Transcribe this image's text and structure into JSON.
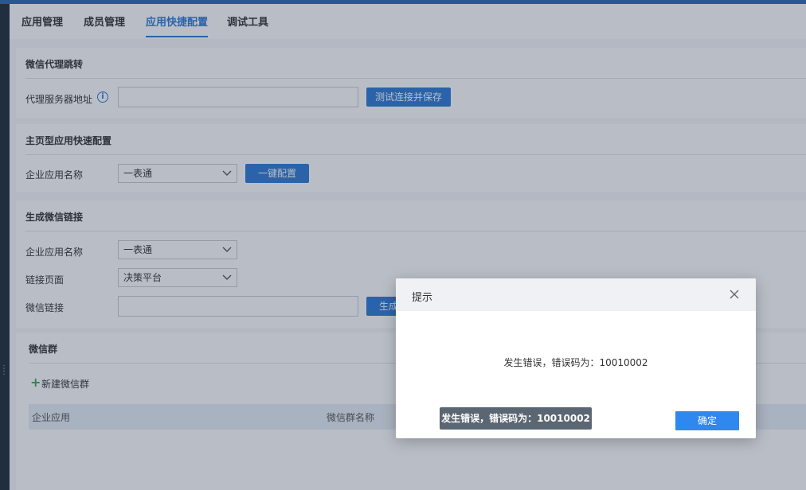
{
  "tabs": [
    {
      "label": "应用管理"
    },
    {
      "label": "成员管理"
    },
    {
      "label": "应用快捷配置"
    },
    {
      "label": "调试工具"
    }
  ],
  "proxy": {
    "title": "微信代理跳转",
    "address_label": "代理服务器地址",
    "address_value": "",
    "test_button": "测试连接并保存"
  },
  "homepage": {
    "title": "主页型应用快速配置",
    "app_label": "企业应用名称",
    "app_value": "一表通",
    "config_button": "一键配置"
  },
  "wxlink": {
    "title": "生成微信链接",
    "app_label": "企业应用名称",
    "app_value": "一表通",
    "page_label": "链接页面",
    "page_value": "决策平台",
    "link_label": "微信链接",
    "link_value": "",
    "generate_button": "生成"
  },
  "group": {
    "title": "微信群",
    "new_label": "新建微信群",
    "columns": [
      "企业应用",
      "微信群名称"
    ]
  },
  "dialog": {
    "title": "提示",
    "message": "发生错误，错误码为：10010002",
    "ok": "确定"
  },
  "toast": {
    "message": "发生错误，错误码为：10010002"
  },
  "colors": {
    "accent": "#2f7ad6",
    "confirm": "#2f88f0"
  }
}
